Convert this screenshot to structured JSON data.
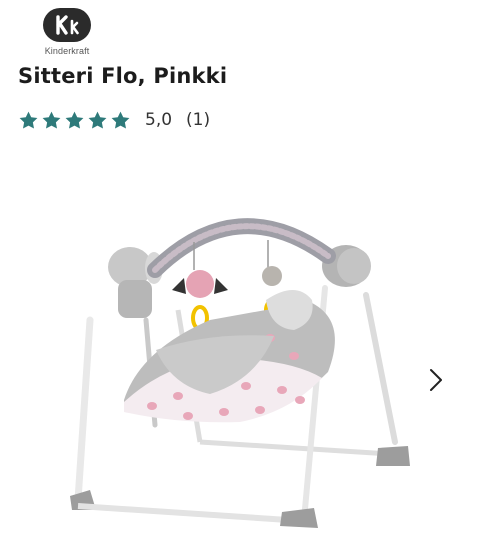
{
  "brand": {
    "logo_text": "Kk",
    "name": "Kinderkraft"
  },
  "product": {
    "title": "Sitteri Flo, Pinkki"
  },
  "rating": {
    "stars": 5,
    "max_stars": 5,
    "score": "5,0",
    "count": "(1)",
    "star_color": "#2e7a7a"
  },
  "gallery": {
    "image_icon": "baby-swing-image",
    "next_icon": "chevron-right-icon"
  }
}
